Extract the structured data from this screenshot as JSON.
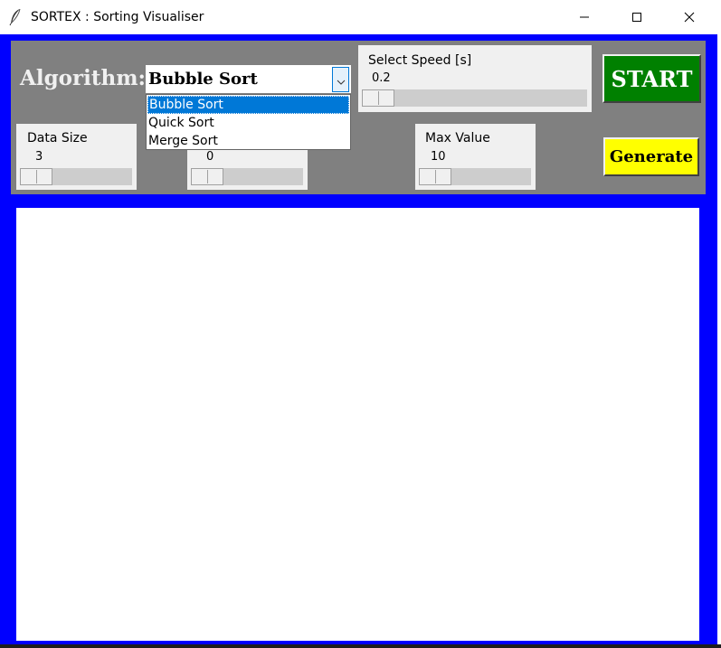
{
  "window": {
    "title": "SORTEX : Sorting Visualiser",
    "icon": "feather-icon"
  },
  "controls": {
    "algorithm_label": "Algorithm:",
    "algorithm_select": {
      "value": "Bubble Sort",
      "options": [
        "Bubble Sort",
        "Quick Sort",
        "Merge Sort"
      ],
      "highlighted": "Bubble Sort"
    },
    "speed": {
      "label": "Select Speed [s]",
      "value": "0.2"
    },
    "data_size": {
      "label": "Data Size",
      "value": "3"
    },
    "min_value": {
      "value": "0"
    },
    "max_value": {
      "label": "Max Value",
      "value": "10"
    },
    "start_label": "START",
    "generate_label": "Generate"
  },
  "colors": {
    "frame": "#0000ff",
    "panel": "#808080",
    "start_button": "#008000",
    "generate_button": "#ffff00",
    "selection": "#0078d7",
    "canvas": "#ffffff"
  }
}
